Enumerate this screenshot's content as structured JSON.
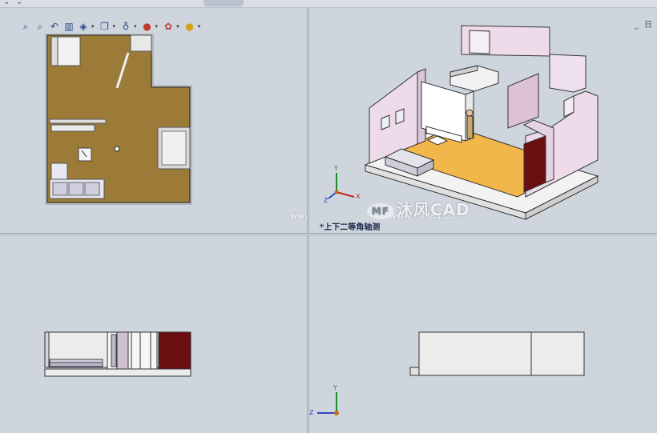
{
  "toolbar": {
    "icons": [
      "zoom-fit-icon",
      "zoom-area-icon",
      "previous-view-icon",
      "section-view-icon",
      "view-orientation-icon",
      "display-style-icon",
      "hide-show-icon",
      "edit-appearance-icon",
      "apply-scene-icon",
      "view-settings-icon"
    ]
  },
  "corner": {
    "label": "_ 日"
  },
  "views": {
    "iso_label": "*上下二等角轴测"
  },
  "axes": {
    "x": "X",
    "y": "Y",
    "z": "Z"
  },
  "watermark": {
    "url_left": "www.mfcad.com",
    "logo_badge": "MF",
    "logo_text": "沐风CAD",
    "url_right": "www.mfcad.com"
  },
  "colors": {
    "floor": "#9c7a38",
    "floor_iso": "#f2b74a",
    "wall_iso": "#e8d6e6",
    "door_dark": "#6a0e10",
    "viewport_bg": "#cfd5dc"
  }
}
